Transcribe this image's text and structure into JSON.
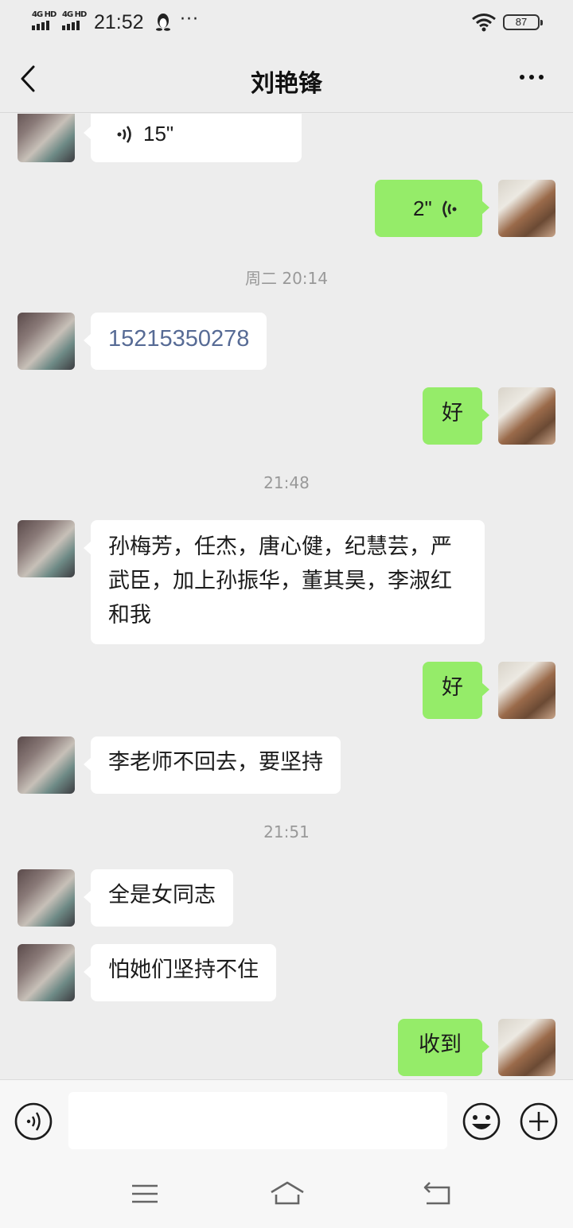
{
  "status_bar": {
    "signal_1": "4G HD",
    "signal_2": "4G HD",
    "time": "21:52",
    "overflow": "···",
    "battery": "87"
  },
  "header": {
    "title": "刘艳锋",
    "back_icon": "chevron-left-icon",
    "more_icon": "more-dots-icon"
  },
  "messages": {
    "m0_voice": "15\"",
    "m1_voice": "2\"",
    "t1": "周二 20:14",
    "m2": "15215350278",
    "m3": "好",
    "t2": "21:48",
    "m4": "孙梅芳，任杰，唐心健，纪慧芸，严武臣，加上孙振华，董其昊，李淑红和我",
    "m5": "好",
    "m6": "李老师不回去，要坚持",
    "t3": "21:51",
    "m7": "全是女同志",
    "m8": "怕她们坚持不住",
    "m9": "收到"
  },
  "input_bar": {
    "voice_icon": "voice-mode-icon",
    "emoji_icon": "emoji-icon",
    "plus_icon": "plus-circle-icon",
    "placeholder": ""
  },
  "nav_bar": {
    "menu_icon": "menu-icon",
    "home_icon": "home-icon",
    "back_icon": "back-icon"
  }
}
